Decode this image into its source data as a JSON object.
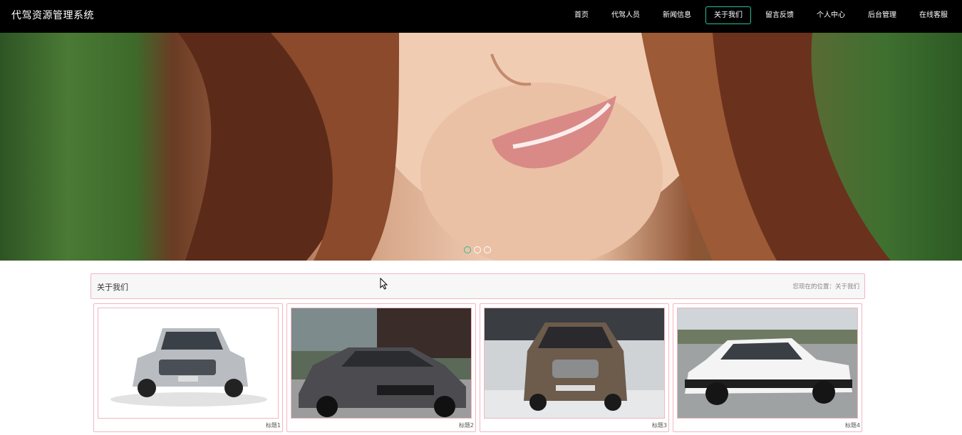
{
  "navbar": {
    "brand": "代驾资源管理系统",
    "items": [
      {
        "label": "首页",
        "active": false
      },
      {
        "label": "代驾人员",
        "active": false
      },
      {
        "label": "新闻信息",
        "active": false
      },
      {
        "label": "关于我们",
        "active": true
      },
      {
        "label": "留言反馈",
        "active": false
      },
      {
        "label": "个人中心",
        "active": false
      },
      {
        "label": "后台管理",
        "active": false
      },
      {
        "label": "在线客服",
        "active": false
      }
    ]
  },
  "hero": {
    "slide_count": 3,
    "active_slide": 1,
    "image_description_icon": "smiling-woman-photo"
  },
  "section": {
    "title": "关于我们",
    "location_prefix": "您现在的位置：",
    "location_current": "关于我们"
  },
  "cards": [
    {
      "caption": "标题1",
      "image_icon": "silver-suv-photo"
    },
    {
      "caption": "标题2",
      "image_icon": "gray-sedan-photo"
    },
    {
      "caption": "标题3",
      "image_icon": "brown-mpv-photo"
    },
    {
      "caption": "标题4",
      "image_icon": "white-coupe-photo"
    }
  ],
  "colors": {
    "accent": "#2bbd98",
    "card_border": "#f2b6c3",
    "navbar_bg": "#000000"
  }
}
